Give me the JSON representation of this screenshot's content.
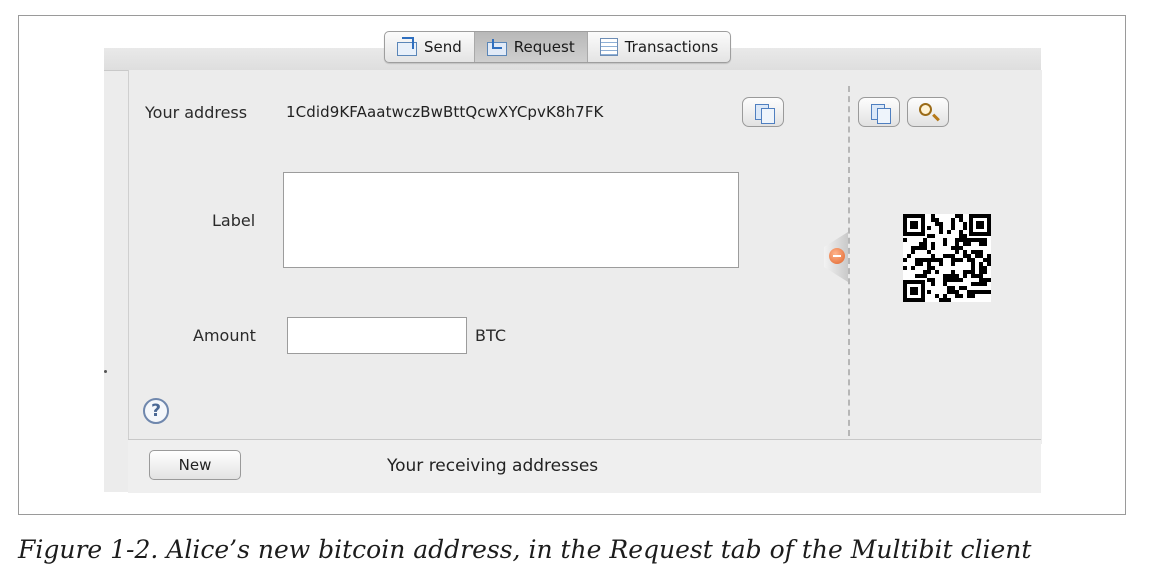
{
  "tabs": [
    {
      "label": "Send",
      "icon": "send-icon",
      "active": false
    },
    {
      "label": "Request",
      "icon": "request-icon",
      "active": true
    },
    {
      "label": "Transactions",
      "icon": "transactions-icon",
      "active": false
    }
  ],
  "request": {
    "address_label": "Your address",
    "address_value": "1Cdid9KFAaatwczBwBttQcwXYCpvK8h7FK",
    "label_label": "Label",
    "label_value": "",
    "amount_label": "Amount",
    "amount_value": "",
    "amount_unit": "BTC"
  },
  "icons": {
    "copy_address": "copy-icon",
    "copy_qr": "copy-icon",
    "zoom_qr": "magnifier-icon",
    "help": "help-icon",
    "collapse": "collapse-icon",
    "qr": "qr-code"
  },
  "help_glyph": "?",
  "bottom": {
    "new_label": "New",
    "receiving_title": "Your receiving addresses"
  },
  "caption": "Figure 1-2. Alice’s new bitcoin address, in the Request tab of the Multibit client",
  "colors": {
    "accent_blue": "#4f7fc0",
    "collapse_orange": "#e0652c"
  }
}
